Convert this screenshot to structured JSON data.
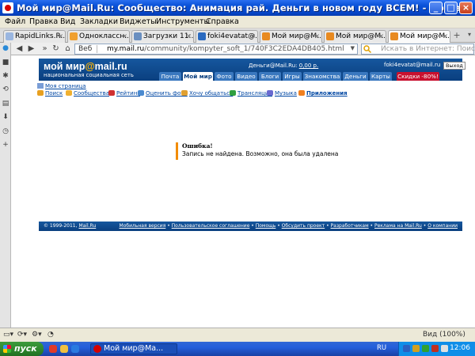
{
  "window": {
    "title": "Мой мир@Mail.Ru: Сообщество: Анимация рай. Деньги в новом году ВСЕМ! - Opera",
    "minimize": "_",
    "maximize": "□",
    "close": "×"
  },
  "menu": [
    "Файл",
    "Правка",
    "Вид",
    "Закладки",
    "Виджеты",
    "Инструменты",
    "Справка"
  ],
  "tabs": [
    {
      "label": "RapidLinks.R...",
      "close": "×",
      "color": "#9ab6e0"
    },
    {
      "label": "Одноклассн...",
      "close": "×",
      "color": "#f0a030"
    },
    {
      "label": "Загрузки 11:...",
      "close": "×",
      "color": "#6a8fc0"
    },
    {
      "label": "foki4evatat@...",
      "close": "×",
      "color": "#2a6ac0"
    },
    {
      "label": "Мой мир@M...",
      "close": "×",
      "color": "#e88a20"
    },
    {
      "label": "Мой мир@M...",
      "close": "×",
      "color": "#e88a20"
    },
    {
      "label": "Мой мир@M...",
      "close": "×",
      "color": "#e88a20",
      "active": true
    }
  ],
  "addressbar": {
    "label": "Веб",
    "url_host": "my.mail.ru",
    "url_path": "/community/kompyter_soft_1/740F3C2EDA4DB405.html",
    "search_placeholder": "Искать в Интернет: Поиск@"
  },
  "site": {
    "logo_main": "мой мир",
    "logo_at": "@",
    "logo_tail": "mail.ru",
    "tagline": "национальная социальная сеть",
    "money_label": "Деньги@Mail.Ru:",
    "money_value": "0,00 р.",
    "user_email": "foki4evatat@mail.ru",
    "logout": "Выход",
    "nav": [
      "Почта",
      "Мой мир",
      "Фото",
      "Видео",
      "Блоги",
      "Игры",
      "Знакомства",
      "Деньги",
      "Карты",
      "Скидки -80%!"
    ],
    "my_page": "Моя страница",
    "quick_links": [
      "Поиск",
      "Сообщества",
      "Рейтинг",
      "Оценить фото",
      "Хочу общаться",
      "Трансляции",
      "Музыка",
      "Приложения"
    ],
    "error_title": "Ошибка!",
    "error_message": "Запись не найдена. Возможно, она была удалена",
    "footer_copy": "© 1999-2011,",
    "footer_copy_link": "Mail.Ru",
    "footer_links": [
      "Мобильная версия",
      "Пользовательское соглашение",
      "Помощь",
      "Обсудить проект",
      "Разработчикам",
      "Реклама на Mail.Ru",
      "О компании"
    ]
  },
  "statusbar": {
    "zoom": "Вид (100%)"
  },
  "taskbar": {
    "start": "пуск",
    "task_label": "Мой мир@Ma...",
    "lang": "RU",
    "clock": "12:06"
  }
}
